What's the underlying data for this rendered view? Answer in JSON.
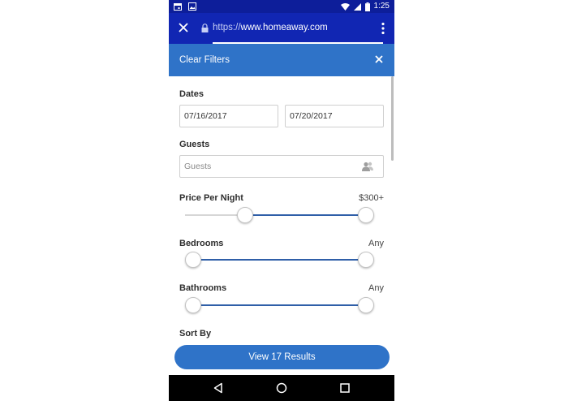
{
  "status_bar": {
    "time": "1:25"
  },
  "browser": {
    "url_scheme": "https://",
    "url_host": "www.homeaway.com"
  },
  "filters": {
    "header_title": "Clear Filters",
    "dates": {
      "label": "Dates",
      "checkin": "07/16/2017",
      "checkout": "07/20/2017"
    },
    "guests": {
      "label": "Guests",
      "placeholder": "Guests"
    },
    "price": {
      "label": "Price Per Night",
      "value": "$300+",
      "range_fraction": [
        0.3,
        1.0
      ]
    },
    "bedrooms": {
      "label": "Bedrooms",
      "value": "Any",
      "range_fraction": [
        0.0,
        1.0
      ]
    },
    "bathrooms": {
      "label": "Bathrooms",
      "value": "Any",
      "range_fraction": [
        0.0,
        1.0
      ]
    },
    "sort": {
      "label": "Sort By"
    }
  },
  "results_button": {
    "label": "View 17 Results"
  },
  "colors": {
    "status_bar": "#0d1e9a",
    "url_bar": "#1126b3",
    "accent": "#2f73c8",
    "slider_fill": "#2f5fa8"
  }
}
